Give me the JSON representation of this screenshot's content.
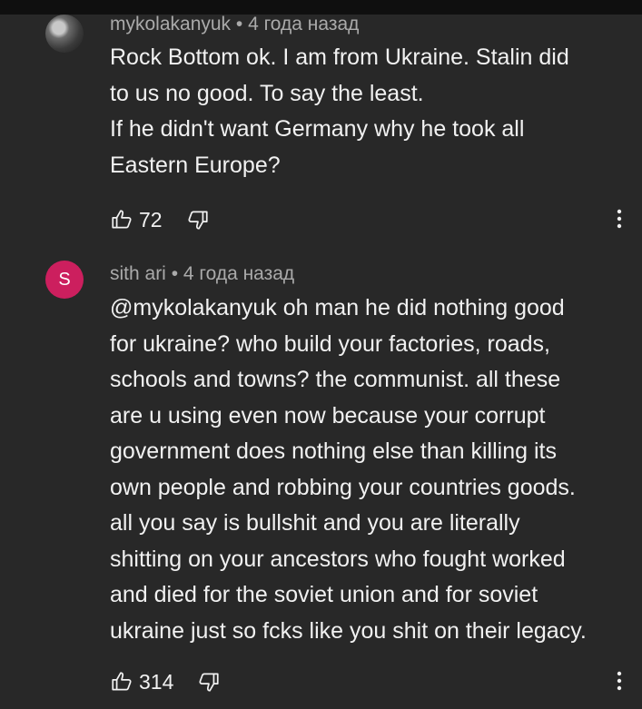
{
  "comments": [
    {
      "author": "mykolakanyuk",
      "time": "• 4 года назад",
      "avatar_icon": "user-photo-avatar",
      "lines": [
        "Rock Bottom ok. I am from Ukraine.  Stalin did",
        "to us no good. To say the least.",
        "If he didn't want Germany why he took all",
        "Eastern Europe?"
      ],
      "likes": "72"
    },
    {
      "author": "sith ari",
      "time": "• 4 года назад",
      "avatar_letter": "S",
      "avatar_color": "#cc1f5e",
      "lines": [
        "@mykolakanyuk oh man he did nothing good",
        "for ukraine? who build your factories, roads,",
        "schools and towns? the communist. all these",
        "are u using even now because your corrupt",
        "government does nothing else than killing its",
        "own people and robbing your countries goods.",
        "all you say is bullshit and you are literally",
        "shitting on your ancestors who fought worked",
        "and died for the soviet union and for soviet",
        "ukraine just so fcks like you shit on their legacy."
      ],
      "likes": "314"
    }
  ],
  "icons": {
    "like": "thumbs-up-icon",
    "dislike": "thumbs-down-icon",
    "more": "more-vert-icon"
  },
  "colors": {
    "background": "#282828",
    "text": "#f1f1f1",
    "meta": "#aaaaaa"
  }
}
